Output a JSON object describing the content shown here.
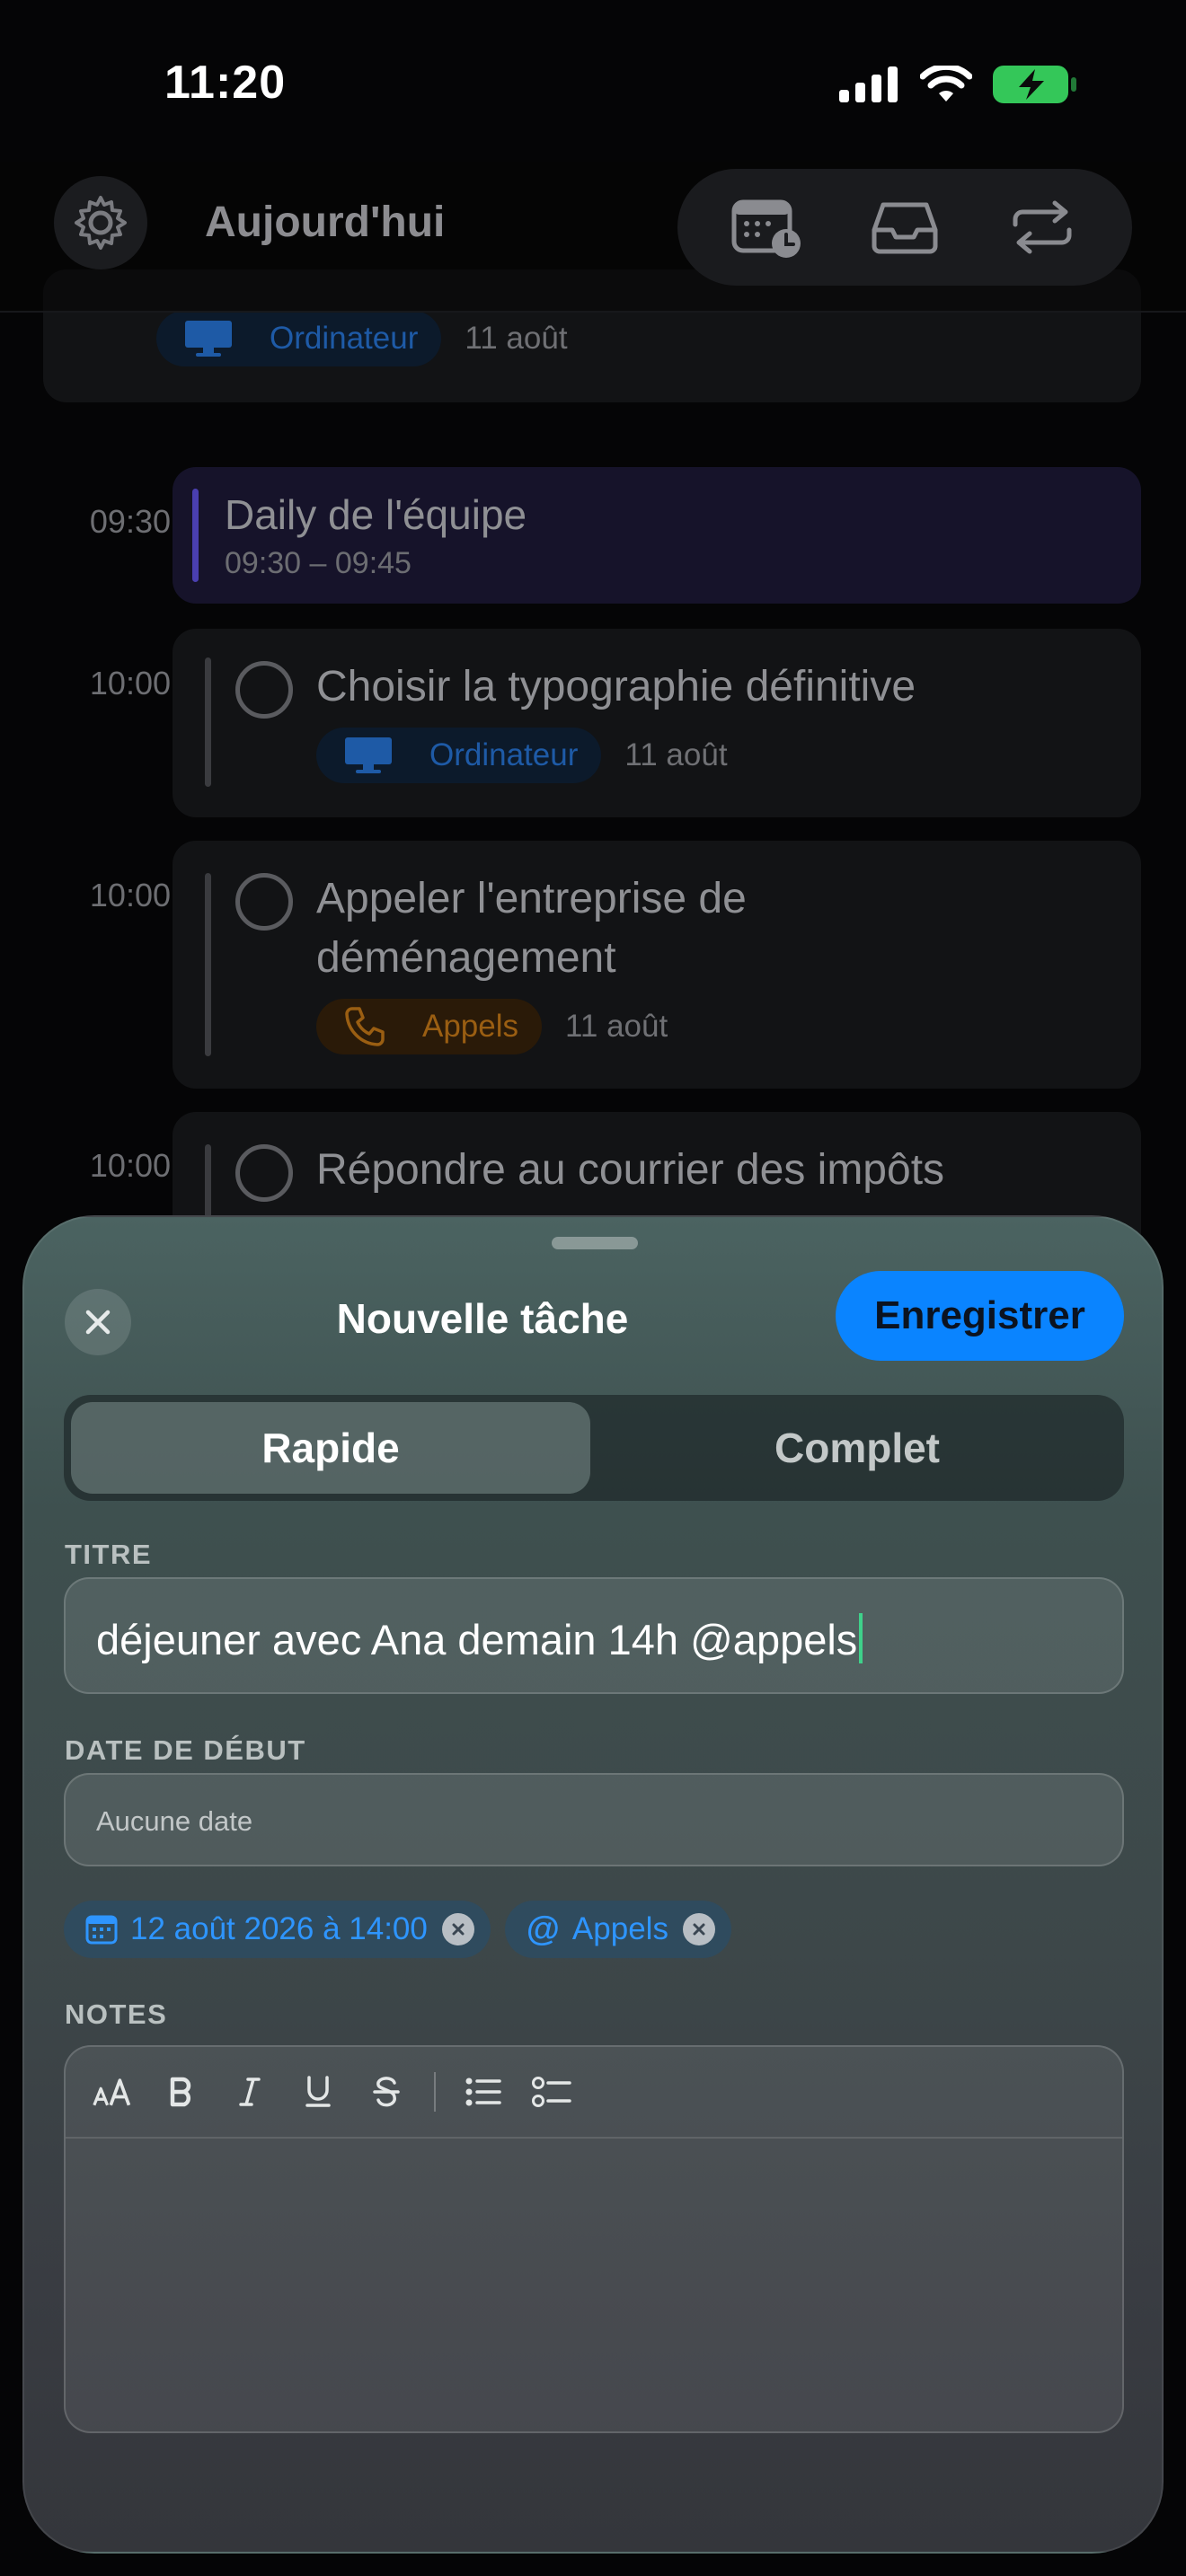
{
  "status_bar": {
    "time": "11:20"
  },
  "header": {
    "title": "Aujourd'hui",
    "icons": [
      "gear-icon",
      "calendar-clock-icon",
      "inbox-icon",
      "repeat-icon"
    ]
  },
  "timeline": {
    "top_card": {
      "tag": "Ordinateur",
      "date": "11 août"
    },
    "items": [
      {
        "time": "09:30",
        "title": "Daily de l'équipe",
        "range": "09:30 – 09:45"
      },
      {
        "time": "10:00",
        "title": "Choisir la typographie définitive",
        "tag": "Ordinateur",
        "date": "11 août"
      },
      {
        "time": "10:00",
        "title_line1": "Appeler l'entreprise de",
        "title_line2": "déménagement",
        "tag": "Appels",
        "date": "11 août"
      },
      {
        "time": "10:00",
        "title": "Répondre au courrier des impôts"
      }
    ]
  },
  "sheet": {
    "title": "Nouvelle tâche",
    "save_label": "Enregistrer",
    "segments": {
      "quick": "Rapide",
      "full": "Complet",
      "selected": "quick"
    },
    "title_label": "TITRE",
    "title_value": "déjeuner avec Ana demain 14h @appels",
    "start_date_label": "DATE DE DÉBUT",
    "start_date_placeholder": "Aucune date",
    "tokens": {
      "date": "12 août 2026 à 14:00",
      "context": "Appels"
    },
    "notes_label": "NOTES",
    "format_buttons": [
      "text-size-icon",
      "bold-icon",
      "italic-icon",
      "underline-icon",
      "strikethrough-icon",
      "bullet-list-icon",
      "checklist-icon"
    ]
  },
  "colors": {
    "accent": "#0a84ff",
    "caret": "#3fd18a",
    "battery": "#34c759",
    "event_bar": "#4a3fb0",
    "calls": "#9a5e12"
  }
}
